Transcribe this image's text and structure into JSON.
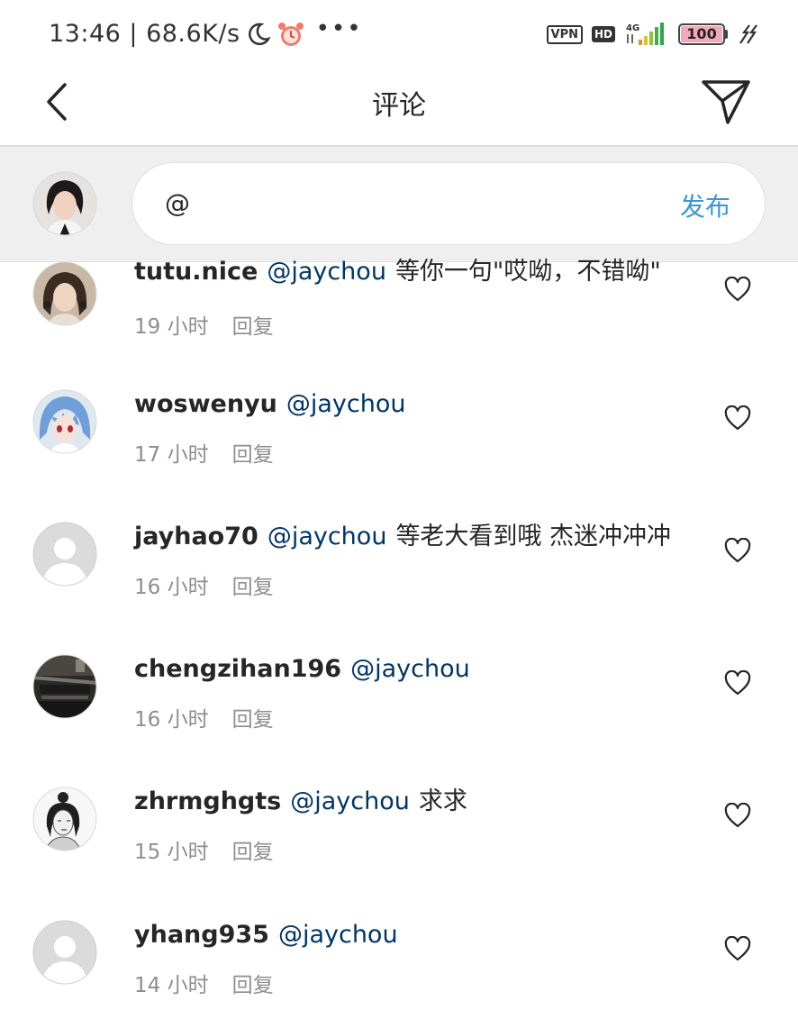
{
  "status_bar": {
    "time": "13:46",
    "speed": "68.6K/s",
    "vpn": "VPN",
    "hd": "HD",
    "network": "4G",
    "battery": "100",
    "icons": [
      "moon-icon",
      "alarm-icon",
      "more-dots-icon",
      "signal-icon",
      "charging-icon"
    ]
  },
  "header": {
    "title": "评论",
    "back_icon": "chevron-left-icon",
    "send_icon": "paper-plane-icon"
  },
  "composer": {
    "input_value": "@",
    "publish_label": "发布"
  },
  "colors": {
    "mention": "#003569",
    "publish": "#3c96d2",
    "meta": "#8e8e8e",
    "composer_bg": "#efefef"
  },
  "comments": [
    {
      "username": "tutu.nice",
      "mention": "@jaychou",
      "text": "等你一句\"哎呦，不错呦\"",
      "time": "19 小时",
      "reply": "回复"
    },
    {
      "username": "woswenyu",
      "mention": "@jaychou",
      "text": "",
      "time": "17 小时",
      "reply": "回复"
    },
    {
      "username": "jayhao70",
      "mention": "@jaychou",
      "text": "等老大看到哦 杰迷冲冲冲",
      "time": "16 小时",
      "reply": "回复"
    },
    {
      "username": "chengzihan196",
      "mention": "@jaychou",
      "text": "",
      "time": "16 小时",
      "reply": "回复"
    },
    {
      "username": "zhrmghgts",
      "mention": "@jaychou",
      "text": "求求",
      "time": "15 小时",
      "reply": "回复"
    },
    {
      "username": "yhang935",
      "mention": "@jaychou",
      "text": "",
      "time": "14 小时",
      "reply": "回复"
    }
  ]
}
